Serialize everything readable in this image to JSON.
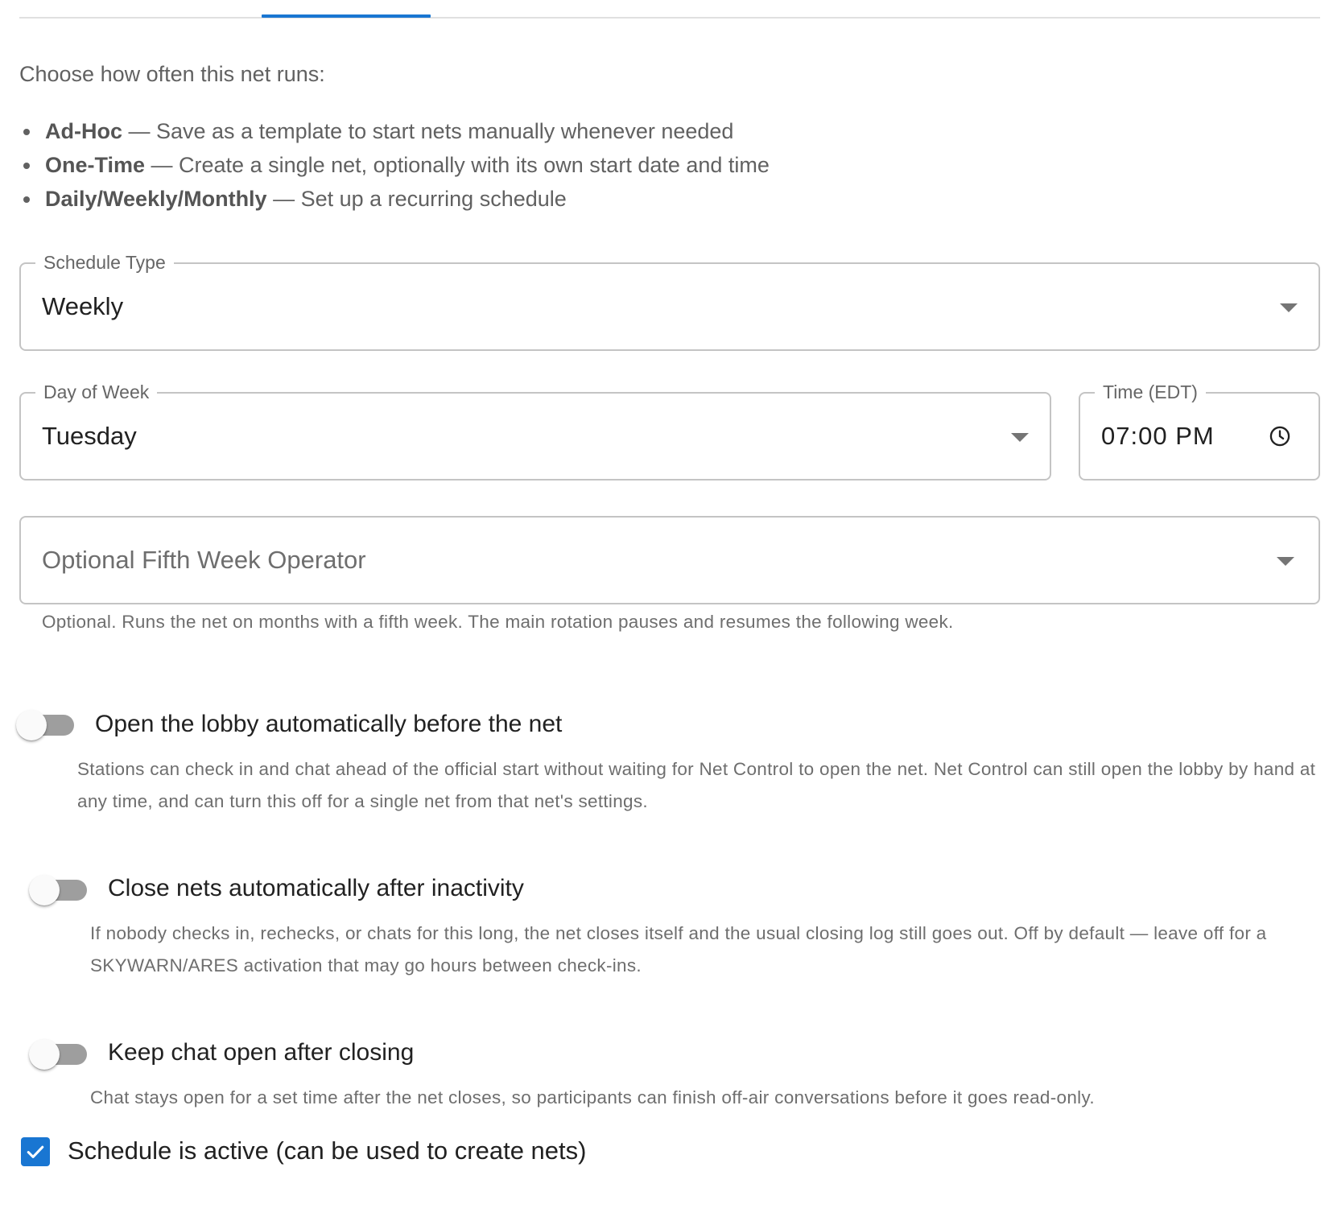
{
  "intro": {
    "text": "Choose how often this net runs:",
    "options": [
      {
        "name": "Ad-Hoc",
        "description": " — Save as a template to start nets manually whenever needed"
      },
      {
        "name": "One-Time",
        "description": " — Create a single net, optionally with its own start date and time"
      },
      {
        "name": "Daily/Weekly/Monthly",
        "description": " — Set up a recurring schedule"
      }
    ]
  },
  "schedule_type": {
    "label": "Schedule Type",
    "value": "Weekly",
    "icon": "chevron-down-icon"
  },
  "day_of_week": {
    "label": "Day of Week",
    "value": "Tuesday",
    "icon": "chevron-down-icon"
  },
  "time": {
    "label": "Time (EDT)",
    "value": "07:00 PM",
    "icon": "clock-icon"
  },
  "fifth_week_operator": {
    "placeholder": "Optional Fifth Week Operator",
    "helper": "Optional. Runs the net on months with a fifth week. The main rotation pauses and resumes the following week.",
    "icon": "chevron-down-icon"
  },
  "toggles": [
    {
      "label": "Open the lobby automatically before the net",
      "description": "Stations can check in and chat ahead of the official start without waiting for Net Control to open the net. Net Control can still open the lobby by hand at any time, and can turn this off for a single net from that net's settings.",
      "checked": false
    },
    {
      "label": "Close nets automatically after inactivity",
      "description": "If nobody checks in, rechecks, or chats for this long, the net closes itself and the usual closing log still goes out. Off by default — leave off for a SKYWARN/ARES activation that may go hours between check-ins.",
      "checked": false
    },
    {
      "label": "Keep chat open after closing",
      "description": "Chat stays open for a set time after the net closes, so participants can finish off-air conversations before it goes read-only.",
      "checked": false
    }
  ],
  "active_checkbox": {
    "label": "Schedule is active (can be used to create nets)",
    "checked": true
  },
  "colors": {
    "accent": "#1976d2",
    "border": "#c4c4c4",
    "secondary_text": "#6e6e6e",
    "switch_track_off": "#9e9e9e"
  }
}
